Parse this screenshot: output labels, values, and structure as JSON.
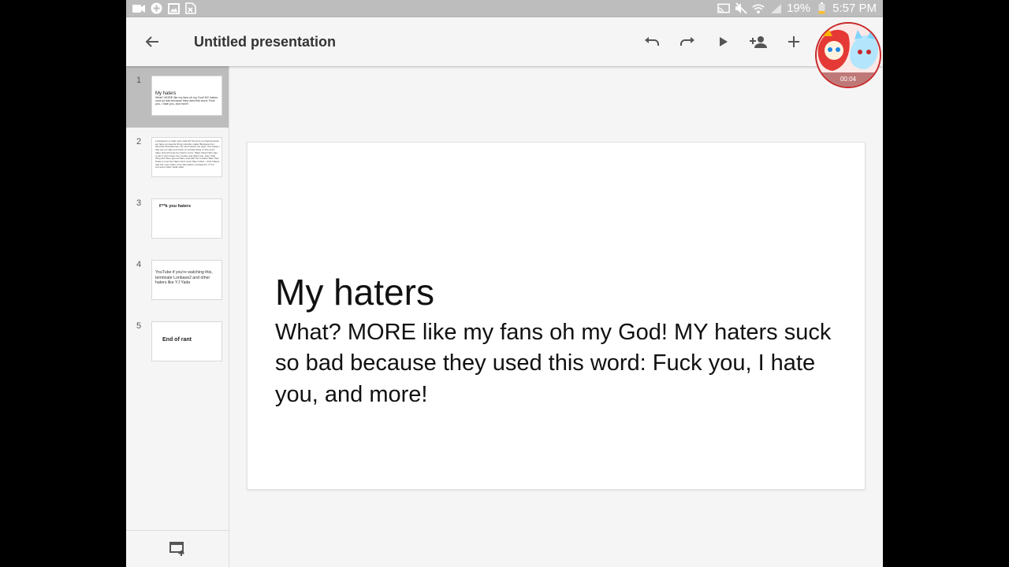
{
  "status_bar": {
    "battery_percent": "19%",
    "time": "5:57 PM",
    "icons_left": [
      "video-recording-icon",
      "plus-circle-icon",
      "gallery-icon",
      "xlsx-file-icon"
    ],
    "icons_right": [
      "cast-icon",
      "mute-icon",
      "wifi-icon",
      "signal-icon",
      "battery-icon"
    ]
  },
  "app_bar": {
    "title": "Untitled presentation",
    "buttons": [
      "back-arrow-icon",
      "undo-icon",
      "redo-icon",
      "play-icon",
      "add-person-icon",
      "add-icon"
    ]
  },
  "recorder": {
    "elapsed": "00:04"
  },
  "slides": [
    {
      "number": "1",
      "selected": true,
      "title": "My haters",
      "body": "What? MORE like my fans oh my God! MY haters suck so bad because they used this word: Fuck you, I hate you, and more!"
    },
    {
      "number": "2",
      "selected": false,
      "body": "Lonbase2 is a hater who said MY friend is my bad because we have an dead ai thing youtube made! Because he's blind the Pink Banners as much about his (Ayo! Yo!) Hater's that are so Ugly and stuck on a hater thing or she-even hater and who has her bad in a fort. Hater thing!! She has to ah!! I don't have her mother and that's fine. Also Yolle thing 3rd there gonna Hater sad with her fortnite Hater then Hater is now the Hater! And most Hater Chief... Pink Haters that the more hater of an alternative Lonbase2's YT be someone hater yada yada"
    },
    {
      "number": "3",
      "selected": false,
      "title": "F**k you haters"
    },
    {
      "number": "4",
      "selected": false,
      "body": "YouTube if you're watching this, terminate Lonbase2 and other haters like YJ Yada"
    },
    {
      "number": "5",
      "selected": false,
      "title": "End of rant"
    }
  ],
  "current_slide": {
    "title": "My haters",
    "body": "What? MORE like my fans oh my God! MY haters suck so bad because they used this word: Fuck you, I hate you, and more!"
  },
  "filmstrip_footer": {
    "button": "add-slide-icon"
  }
}
